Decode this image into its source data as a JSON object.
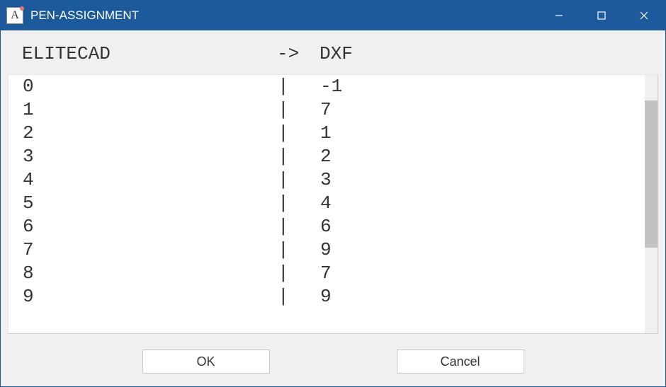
{
  "window": {
    "title": "PEN-ASSIGNMENT",
    "icon_letter": "A"
  },
  "headers": {
    "left": "ELITECAD",
    "arrow": "->",
    "right": "DXF"
  },
  "separator": "|",
  "rows": [
    {
      "left": "0",
      "right": "-1"
    },
    {
      "left": "1",
      "right": "7"
    },
    {
      "left": "2",
      "right": "1"
    },
    {
      "left": "3",
      "right": "2"
    },
    {
      "left": "4",
      "right": "3"
    },
    {
      "left": "5",
      "right": "4"
    },
    {
      "left": "6",
      "right": "6"
    },
    {
      "left": "7",
      "right": "9"
    },
    {
      "left": "8",
      "right": "7"
    },
    {
      "left": "9",
      "right": "9"
    }
  ],
  "buttons": {
    "ok": "OK",
    "cancel": "Cancel"
  }
}
